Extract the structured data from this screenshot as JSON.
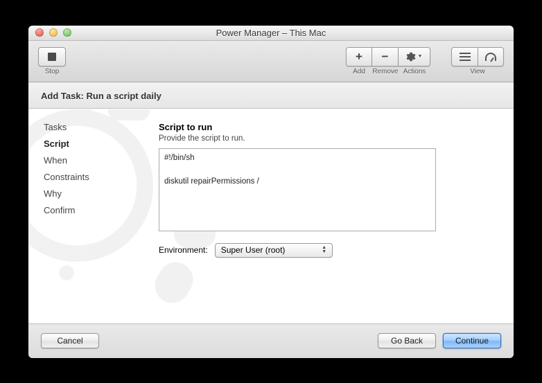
{
  "window": {
    "title": "Power Manager – This Mac"
  },
  "toolbar": {
    "stop_label": "Stop",
    "add_label": "Add",
    "remove_label": "Remove",
    "actions_label": "Actions",
    "view_label": "View"
  },
  "sheet": {
    "header": "Add Task: Run a script daily",
    "nav": {
      "items": [
        {
          "label": "Tasks"
        },
        {
          "label": "Script"
        },
        {
          "label": "When"
        },
        {
          "label": "Constraints"
        },
        {
          "label": "Why"
        },
        {
          "label": "Confirm"
        }
      ],
      "active_index": 1
    },
    "main": {
      "title": "Script to run",
      "subtitle": "Provide the script to run.",
      "script_value": "#!/bin/sh\n\ndiskutil repairPermissions /",
      "env_label": "Environment:",
      "env_value": "Super User (root)"
    },
    "buttons": {
      "cancel": "Cancel",
      "go_back": "Go Back",
      "continue": "Continue"
    }
  }
}
